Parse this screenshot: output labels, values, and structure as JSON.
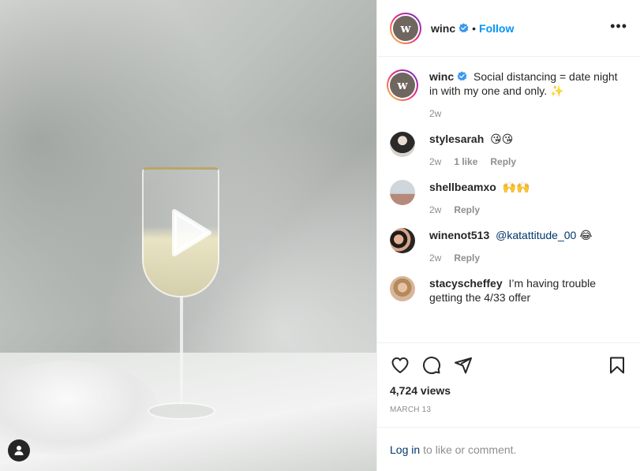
{
  "post": {
    "account": "winc",
    "avatar_letter": "w",
    "follow_label": "Follow",
    "separator": "•",
    "more_label": "•••"
  },
  "caption": {
    "user": "winc",
    "text": "Social distancing = date night in with my one and only. ✨",
    "time": "2w"
  },
  "comments": [
    {
      "user": "stylesarah",
      "text": "😘😘",
      "time": "2w",
      "likes": "1 like",
      "reply": "Reply"
    },
    {
      "user": "shellbeamxo",
      "text": "🙌🙌",
      "time": "2w",
      "reply": "Reply"
    },
    {
      "user": "winenot513",
      "mention": "@katattitude_00",
      "text": "😂",
      "time": "2w",
      "reply": "Reply"
    },
    {
      "user": "stacyscheffey",
      "text": "I’m having trouble getting the 4/33 offer"
    }
  ],
  "stats": {
    "views": "4,724 views",
    "date": "MARCH 13"
  },
  "login": {
    "link": "Log in",
    "rest": "to like or comment."
  },
  "icons": [
    "play-icon",
    "user-tag-icon",
    "verified-icon",
    "more-icon",
    "heart-icon",
    "comment-icon",
    "share-icon",
    "bookmark-icon"
  ],
  "colors": {
    "link": "#0095f6",
    "muted": "#8e8e8e",
    "text": "#262626"
  }
}
